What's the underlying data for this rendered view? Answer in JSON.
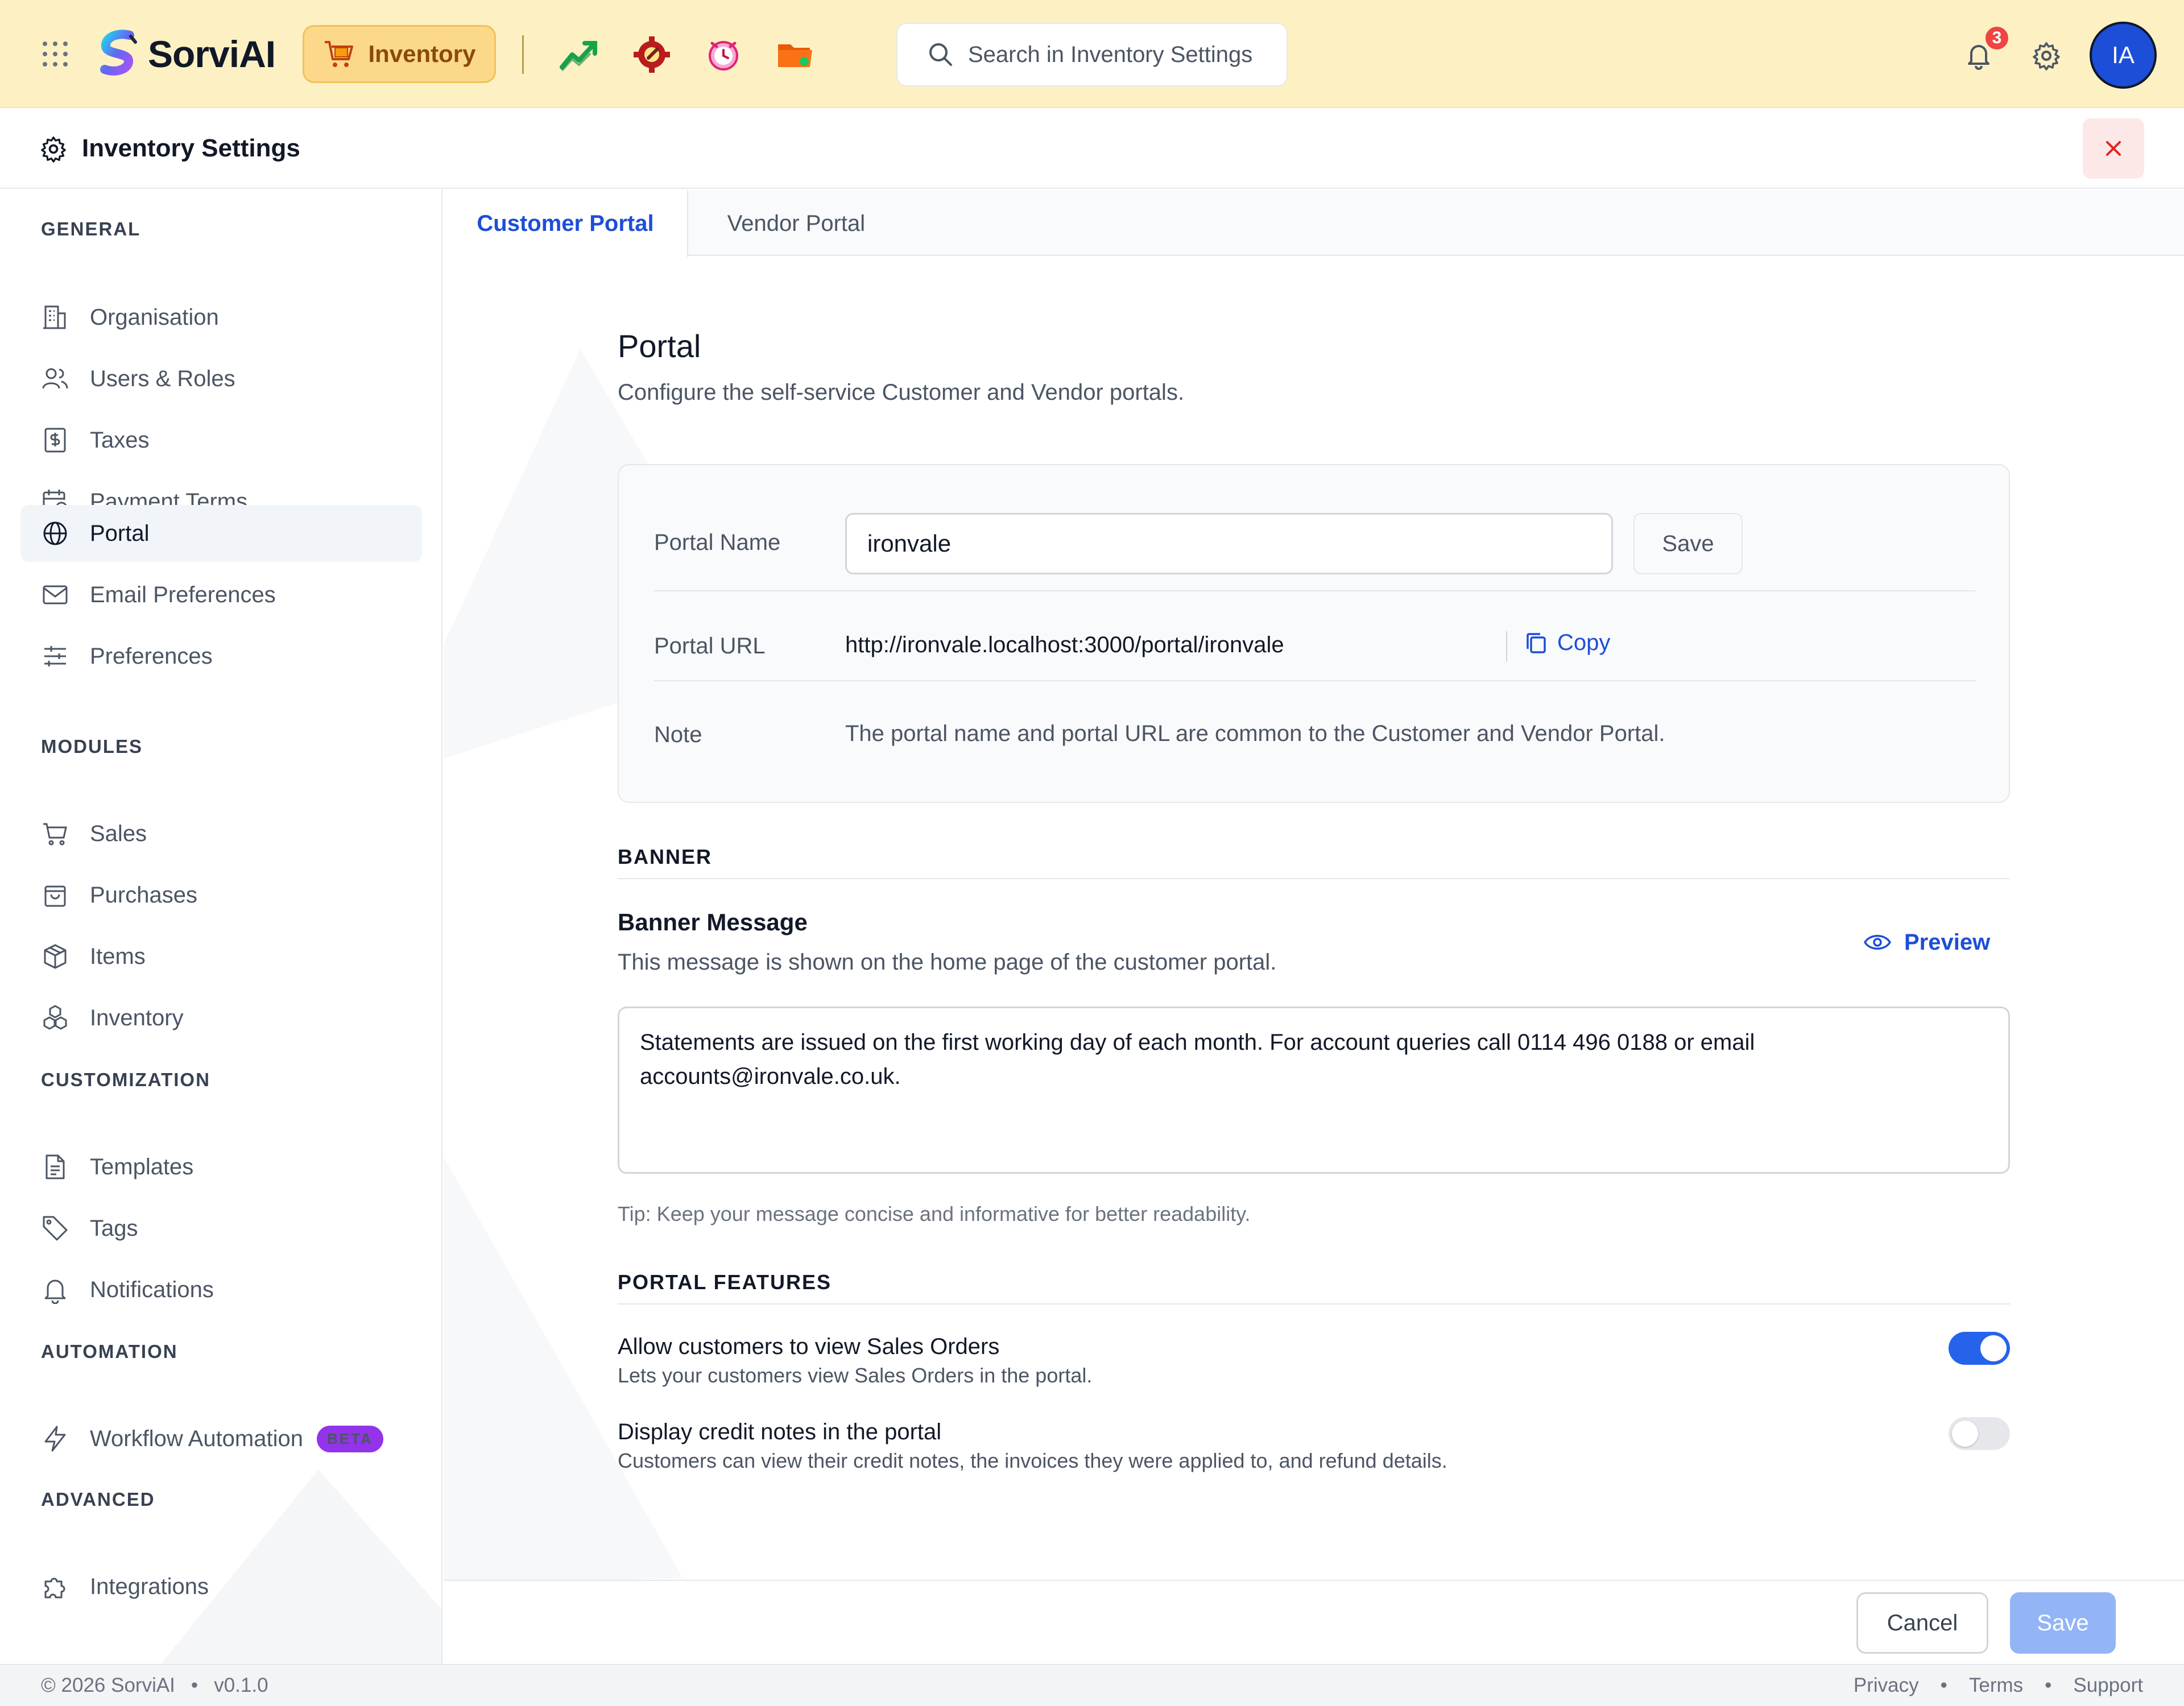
{
  "brand": {
    "name": "SorviAI"
  },
  "topbar": {
    "module_label": "Inventory",
    "search_placeholder": "Search in Inventory Settings",
    "notification_count": "3",
    "avatar_initials": "IA"
  },
  "header": {
    "title": "Inventory Settings"
  },
  "sidebar": {
    "sections": [
      {
        "title": "GENERAL",
        "items": [
          "Organisation",
          "Users & Roles",
          "Taxes",
          "Payment Terms",
          "Portal",
          "Email Preferences",
          "Preferences"
        ]
      },
      {
        "title": "MODULES",
        "items": [
          "Sales",
          "Purchases",
          "Items",
          "Inventory"
        ]
      },
      {
        "title": "CUSTOMIZATION",
        "items": [
          "Templates",
          "Tags",
          "Notifications"
        ]
      },
      {
        "title": "AUTOMATION",
        "items": [
          "Workflow Automation"
        ]
      },
      {
        "title": "ADVANCED",
        "items": [
          "Integrations"
        ]
      }
    ],
    "active_item": "Portal",
    "beta_badge": "BETA"
  },
  "tabs": [
    {
      "label": "Customer Portal",
      "active": true
    },
    {
      "label": "Vendor Portal",
      "active": false
    }
  ],
  "portal": {
    "heading": "Portal",
    "subheading": "Configure the self-service Customer and Vendor portals.",
    "name_label": "Portal Name",
    "name_value": "ironvale",
    "save_label": "Save",
    "url_label": "Portal URL",
    "url_value": "http://ironvale.localhost:3000/portal/ironvale",
    "copy_label": "Copy",
    "note_label": "Note",
    "note_text": "The portal name and portal URL are common to the Customer and Vendor Portal."
  },
  "banner": {
    "section_title": "BANNER",
    "title": "Banner Message",
    "subtitle": "This message is shown on the home page of the customer portal.",
    "preview_label": "Preview",
    "message": "Statements are issued on the first working day of each month. For account queries call 0114 496 0188 or email accounts@ironvale.co.uk.",
    "tip": "Tip: Keep your message concise and informative for better readability."
  },
  "features": {
    "section_title": "PORTAL FEATURES",
    "items": [
      {
        "title": "Allow customers to view Sales Orders",
        "description": "Lets your customers view Sales Orders in the portal.",
        "enabled": true
      },
      {
        "title": "Display credit notes in the portal",
        "description": "Customers can view their credit notes, the invoices they were applied to, and refund details.",
        "enabled": false
      }
    ]
  },
  "actions": {
    "cancel_label": "Cancel",
    "save_label": "Save"
  },
  "status": {
    "copyright": "© 2026 SorviAI",
    "version": "v0.1.0",
    "links": [
      "Privacy",
      "Terms",
      "Support"
    ]
  },
  "colors": {
    "accent": "#1d4ed8",
    "topbar_bg": "#fdf1c4",
    "toggle_on": "#2563eb",
    "beta": "#9333ea"
  }
}
